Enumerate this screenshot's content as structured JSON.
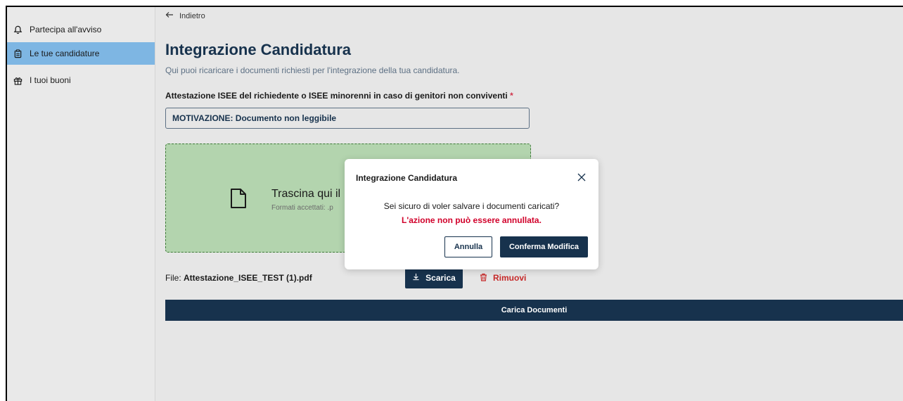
{
  "sidebar": {
    "items": [
      {
        "label": "Partecipa all'avviso",
        "icon": "bell-icon"
      },
      {
        "label": "Le tue candidature",
        "icon": "clipboard-icon",
        "active": true
      },
      {
        "label": "I tuoi buoni",
        "icon": "gift-icon"
      }
    ]
  },
  "main": {
    "back_label": "Indietro",
    "title": "Integrazione Candidatura",
    "subtitle": "Qui puoi ricaricare i documenti richiesti per l'integrazione della tua candidatura.",
    "field_label": "Attestazione ISEE del richiedente o ISEE minorenni in caso di genitori non conviventi",
    "required_mark": "*",
    "motivazione": "MOTIVAZIONE: Documento non leggibile",
    "dropzone": {
      "text": "Trascina qui il",
      "formats": "Formati accettati: .p"
    },
    "file_prefix": "File:",
    "file_name": "Attestazione_ISEE_TEST (1).pdf",
    "download_label": "Scarica",
    "remove_label": "Rimuovi",
    "upload_label": "Carica Documenti"
  },
  "modal": {
    "title": "Integrazione Candidatura",
    "question": "Sei sicuro di voler salvare i documenti caricati?",
    "warning": "L'azione non può essere annullata.",
    "cancel_label": "Annulla",
    "confirm_label": "Conferma Modifica"
  },
  "colors": {
    "primary": "#17324d",
    "active_nav": "#7eb6e3",
    "dropzone_bg": "#b3d4ae",
    "danger": "#c62828"
  }
}
